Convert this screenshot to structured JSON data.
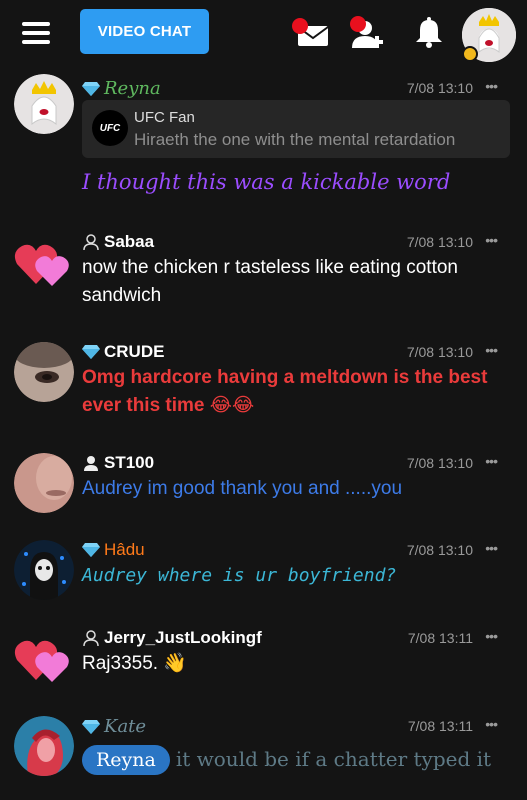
{
  "header": {
    "video_chat_label": "VIDEO CHAT"
  },
  "messages": [
    {
      "username": "Reyna",
      "user_badge": "diamond-icon",
      "time": "7/08 13:10",
      "more": "•••",
      "quote": {
        "avatar_text": "UFC",
        "name": "UFC Fan",
        "text": "Hiraeth the one with the mental retardation"
      },
      "text": "I thought this was a kickable word",
      "color": "#9b4dff"
    },
    {
      "username": "Sabaa",
      "user_badge": "person-outline-icon",
      "time": "7/08 13:10",
      "more": "•••",
      "text": "now the chicken r tasteless like eating cotton sandwich",
      "color": "#ffffff"
    },
    {
      "username": "CRUDE",
      "user_badge": "diamond-icon",
      "time": "7/08 13:10",
      "more": "•••",
      "text": "Omg hardcore having a meltdown is the best ever this time 😂😂",
      "color": "#ea3b3b"
    },
    {
      "username": "ST100",
      "user_badge": "person-filled-icon",
      "time": "7/08 13:10",
      "more": "•••",
      "text": "Audrey im good thank you and .....you",
      "color": "#3d7be8"
    },
    {
      "username": "Hâdu",
      "user_badge": "diamond-icon",
      "time": "7/08 13:10",
      "more": "•••",
      "text": "Audrey where is ur boyfriend?",
      "color": "#3cb7d6"
    },
    {
      "username": "Jerry_JustLookingf",
      "user_badge": "person-outline-icon",
      "time": "7/08 13:11",
      "more": "•••",
      "text": "Raj3355. 👋",
      "color": "#ffffff"
    },
    {
      "username": "Kate",
      "user_badge": "diamond-icon",
      "time": "7/08 13:11",
      "more": "•••",
      "mention": "Reyna",
      "text": "it would be if a chatter typed it",
      "color": "#5e7a86"
    }
  ],
  "colors": {
    "accent": "#2e9cf2",
    "diamond": "#7fd3f7",
    "notification_dot": "#e8101e"
  }
}
